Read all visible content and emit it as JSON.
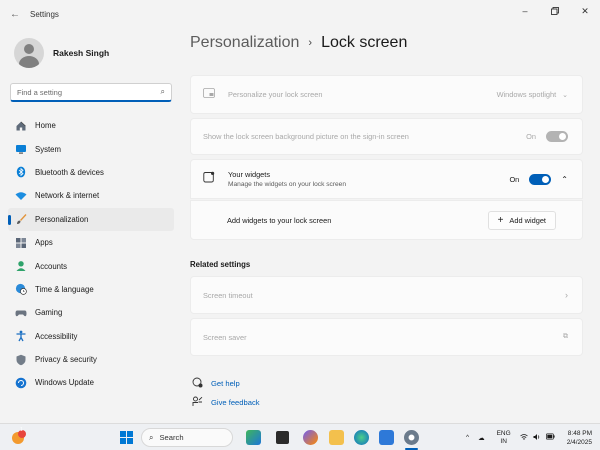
{
  "window": {
    "title": "Settings",
    "back_icon": "arrow-left-icon",
    "controls": [
      "minimize-icon",
      "maximize-icon",
      "close-icon"
    ]
  },
  "profile": {
    "name": "Rakesh Singh"
  },
  "search": {
    "placeholder": "Find a setting",
    "icon": "search-icon"
  },
  "nav": {
    "items": [
      {
        "label": "Home",
        "icon": "home-icon"
      },
      {
        "label": "System",
        "icon": "monitor-icon"
      },
      {
        "label": "Bluetooth & devices",
        "icon": "bluetooth-icon"
      },
      {
        "label": "Network & internet",
        "icon": "wifi-icon"
      },
      {
        "label": "Personalization",
        "icon": "brush-icon",
        "active": true
      },
      {
        "label": "Apps",
        "icon": "apps-icon"
      },
      {
        "label": "Accounts",
        "icon": "person-icon"
      },
      {
        "label": "Time & language",
        "icon": "globe-clock-icon"
      },
      {
        "label": "Gaming",
        "icon": "controller-icon"
      },
      {
        "label": "Accessibility",
        "icon": "accessibility-icon"
      },
      {
        "label": "Privacy & security",
        "icon": "shield-icon"
      },
      {
        "label": "Windows Update",
        "icon": "update-icon"
      }
    ]
  },
  "breadcrumb": {
    "parent": "Personalization",
    "separator": "›",
    "current": "Lock screen"
  },
  "cards": {
    "personalize": {
      "label": "Personalize your lock screen",
      "value": "Windows spotlight"
    },
    "background": {
      "label": "Show the lock screen background picture on the sign-in screen",
      "state": "On"
    },
    "widgets": {
      "title": "Your widgets",
      "subtitle": "Manage the widgets on your lock screen",
      "state": "On"
    },
    "add_widgets": {
      "label": "Add widgets to your lock screen",
      "button": "Add widget"
    }
  },
  "related": {
    "title": "Related settings",
    "items": [
      {
        "label": "Screen timeout"
      },
      {
        "label": "Screen saver"
      }
    ]
  },
  "help": {
    "get_help": "Get help",
    "feedback": "Give feedback"
  },
  "taskbar": {
    "badge": "1",
    "search_label": "Search",
    "tray": {
      "chevron": "^",
      "lang_line1": "ENG",
      "lang_line2": "IN",
      "time": "8:48 PM",
      "date": "2/4/2025"
    }
  },
  "colors": {
    "accent": "#005fb8",
    "background": "#f3f3f3",
    "card": "#fbfbfb"
  }
}
